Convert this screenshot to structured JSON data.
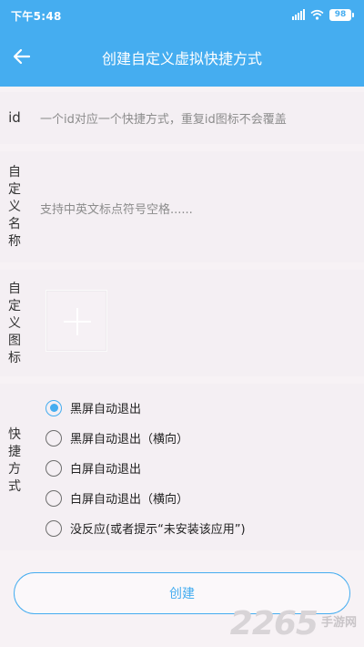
{
  "status_bar": {
    "time": "下午5:48",
    "battery": "98"
  },
  "header": {
    "title": "创建自定义虚拟快捷方式"
  },
  "id_row": {
    "label": "id",
    "placeholder": "一个id对应一个快捷方式，重复id图标不会覆盖"
  },
  "name_row": {
    "label_chars": [
      "自",
      "定",
      "义",
      "名",
      "称"
    ],
    "placeholder": "支持中英文标点符号空格......"
  },
  "icon_row": {
    "label_chars": [
      "自",
      "定",
      "义",
      "图",
      "标"
    ]
  },
  "shortcut_row": {
    "label_chars": [
      "快",
      "捷",
      "方",
      "式"
    ],
    "options": [
      {
        "label": "黑屏自动退出",
        "checked": true
      },
      {
        "label": "黑屏自动退出（横向）",
        "checked": false
      },
      {
        "label": "白屏自动退出",
        "checked": false
      },
      {
        "label": "白屏自动退出（横向）",
        "checked": false
      },
      {
        "label": "没反应(或者提示“未安装该应用”)",
        "checked": false
      }
    ]
  },
  "create_button": {
    "label": "创建"
  },
  "watermark": {
    "number": "2265",
    "text": "手游网"
  },
  "colors": {
    "accent": "#45adf0",
    "background": "#f7f2f5"
  }
}
